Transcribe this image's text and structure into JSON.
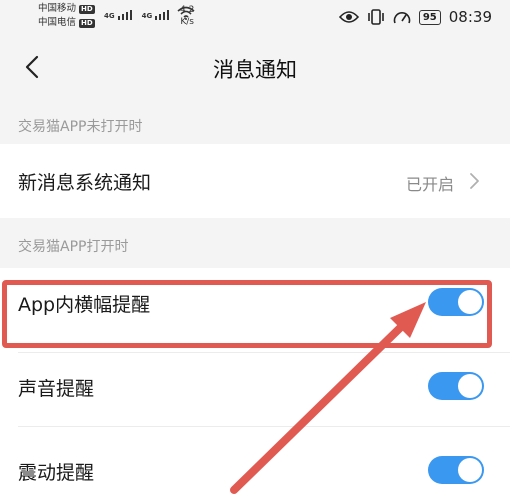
{
  "status_bar": {
    "carrier_1": "中国移动",
    "carrier_2": "中国电信",
    "hd_badge": "HD",
    "signal_label": "4G",
    "net_speed_value": "4.2",
    "net_speed_unit": "K/s",
    "battery": "95",
    "time": "08:39"
  },
  "header": {
    "title": "消息通知"
  },
  "sections": {
    "app_closed": {
      "title": "交易猫APP未打开时",
      "system_notification_label": "新消息系统通知",
      "system_notification_value": "已开启"
    },
    "app_open": {
      "title": "交易猫APP打开时",
      "banner_label": "App内横幅提醒",
      "banner_on": true,
      "sound_label": "声音提醒",
      "sound_on": true,
      "vibration_label": "震动提醒",
      "vibration_on": true
    }
  },
  "colors": {
    "toggle_on": "#3b98f0",
    "annotation": "#e05a52",
    "section_text": "#9a9a9a"
  },
  "icons": [
    "back-arrow-icon",
    "chevron-right-icon",
    "eye-icon",
    "vibrate-icon",
    "speedometer-icon",
    "wifi-icon",
    "signal-icon",
    "battery-icon"
  ]
}
